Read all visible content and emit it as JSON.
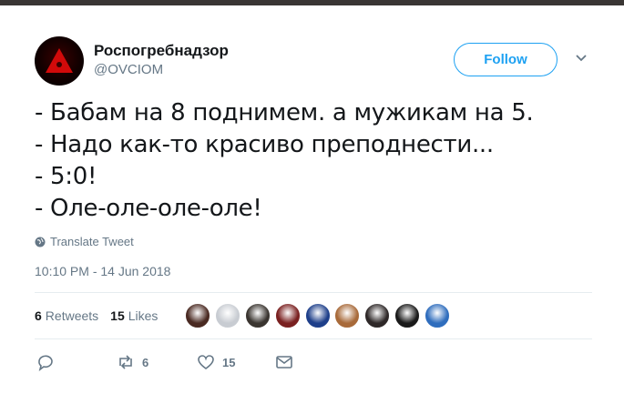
{
  "user": {
    "name": "Роспогребнадзор",
    "handle": "@OVCIOM"
  },
  "follow_label": "Follow",
  "tweet_lines": [
    "- Бабам на 8 поднимем. а мужикам на 5.",
    "- Надо как-то красиво преподнести...",
    "- 5:0!",
    "- Оле-оле-оле-оле!"
  ],
  "translate_label": "Translate Tweet",
  "timestamp": "10:10 PM - 14 Jun 2018",
  "stats": {
    "retweets_count": "6",
    "retweets_label": "Retweets",
    "likes_count": "15",
    "likes_label": "Likes"
  },
  "liker_colors": [
    "#4a2a22",
    "#c8ccd2",
    "#3a3530",
    "#7a2020",
    "#1e3f8a",
    "#a86a3a",
    "#2e2828",
    "#1a1a1a",
    "#2f6dbd"
  ],
  "actions": {
    "reply": "",
    "retweet_count": "6",
    "like_count": "15"
  },
  "colors": {
    "accent": "#1da1f2",
    "secondary": "#657786",
    "avatar_mark": "#d10a0a"
  }
}
